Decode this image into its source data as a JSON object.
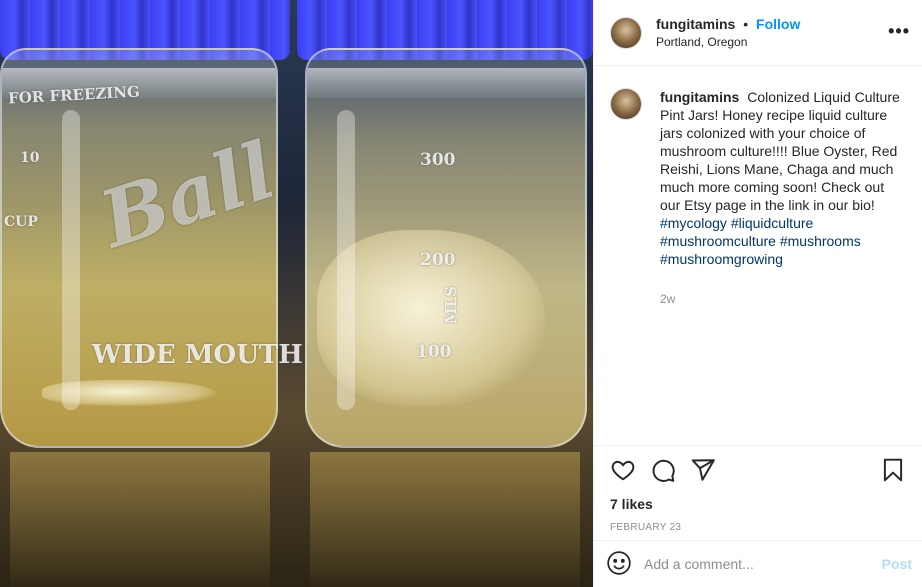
{
  "post": {
    "username": "fungitamins",
    "separator": "•",
    "follow_label": "Follow",
    "location": "Portland, Oregon",
    "more_label": "•••"
  },
  "photo": {
    "etched_left_top": "FOR FREEZING",
    "etched_left_brand": "Ball",
    "etched_left_mouth": "WIDE MOUTH",
    "etched_left_cup": "CUP",
    "etched_left_10": "10",
    "etched_right_300": "300",
    "etched_right_200": "200",
    "etched_right_100": "100",
    "etched_right_mls": "MLS"
  },
  "caption": {
    "username": "fungitamins",
    "text": "Colonized Liquid Culture Pint Jars! Honey recipe liquid culture jars colonized with your choice of mushroom culture!!!! Blue Oyster, Red Reishi, Lions Mane, Chaga and much much more coming soon! Check out our Etsy page in the link in our bio!",
    "hashtags": [
      "#mycology",
      "#liquidculture",
      "#mushroomculture",
      "#mushrooms",
      "#mushroomgrowing"
    ],
    "age": "2w"
  },
  "actions": {
    "icons": [
      "heart-icon",
      "comment-icon",
      "share-icon",
      "bookmark-icon"
    ],
    "likes": "7 likes",
    "date": "FEBRUARY 23"
  },
  "comment_box": {
    "placeholder": "Add a comment...",
    "post_label": "Post"
  },
  "colors": {
    "accent": "#0095f6",
    "hashtag": "#00376b",
    "muted": "#8e8e8e",
    "post_disabled": "#b2dffc"
  }
}
